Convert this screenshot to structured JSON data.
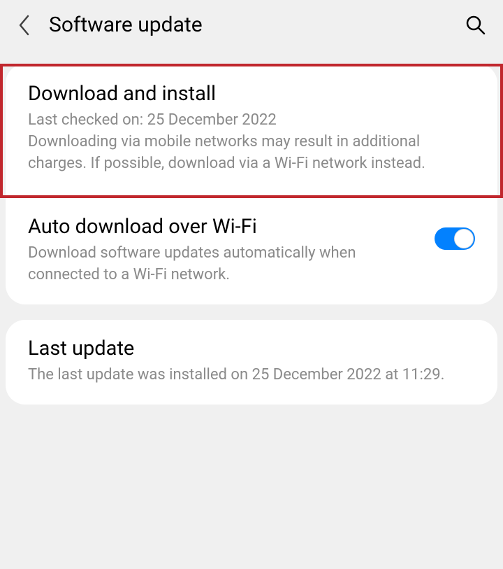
{
  "header": {
    "title": "Software update"
  },
  "sections": {
    "download_install": {
      "title": "Download and install",
      "description": "Last checked on: 25 December 2022\nDownloading via mobile networks may result in additional charges. If possible, download via a Wi-Fi network instead."
    },
    "auto_download": {
      "title": "Auto download over Wi-Fi",
      "description": "Download software updates automatically when connected to a Wi-Fi network.",
      "enabled": true
    },
    "last_update": {
      "title": "Last update",
      "description": "The last update was installed on 25 December 2022 at 11:29."
    }
  }
}
